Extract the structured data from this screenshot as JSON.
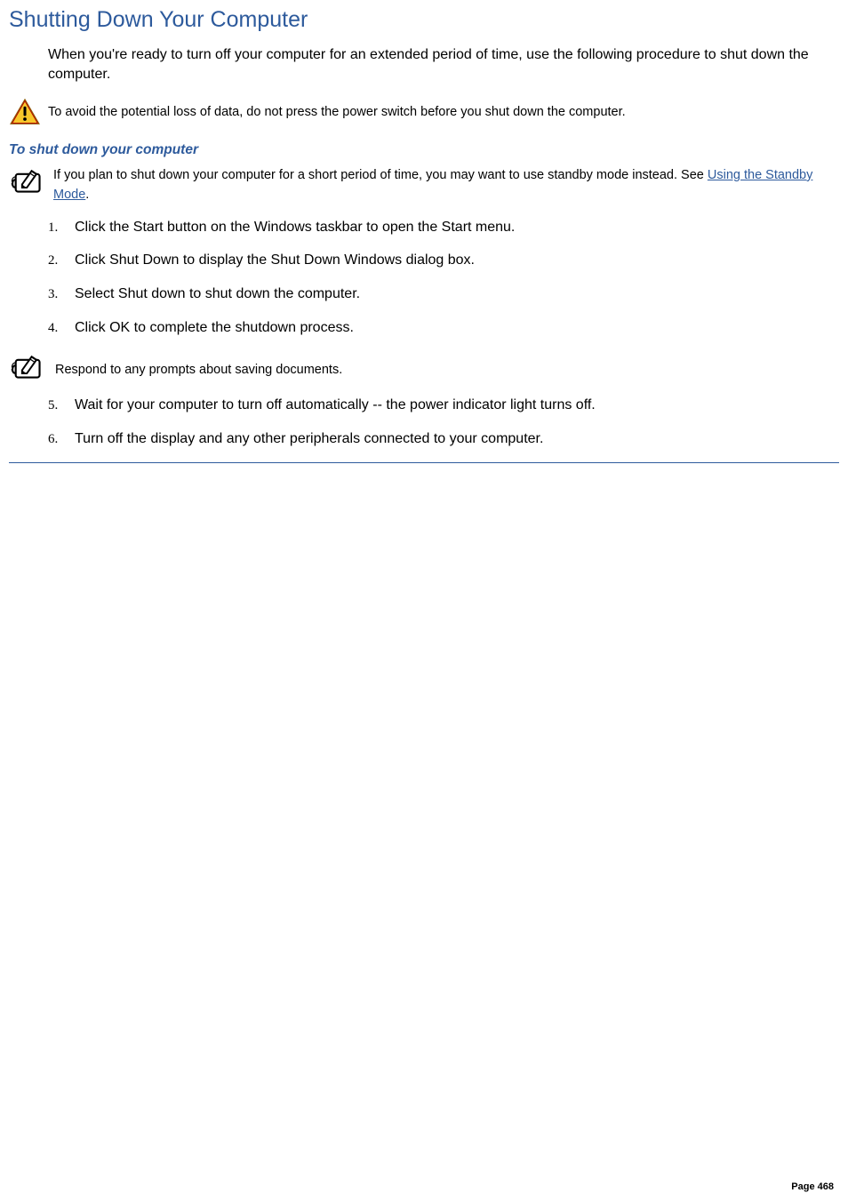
{
  "title": "Shutting Down Your Computer",
  "intro": "When you're ready to turn off your computer for an extended period of time, use the following procedure to shut down the computer.",
  "warning_text": "To avoid the potential loss of data, do not press the power switch before you shut down the computer.",
  "subheading": "To shut down your computer",
  "note1_text_before_link": "If you plan to shut down your computer for a short period of time, you may want to use standby mode instead. See ",
  "note1_link": "Using the Standby Mode",
  "note1_text_after_link": ".",
  "steps_a": [
    "Click the Start button on the Windows taskbar to open the Start menu.",
    "Click Shut Down to display the Shut Down Windows dialog box.",
    "Select Shut down to shut down the computer.",
    "Click OK to complete the shutdown process."
  ],
  "step_nums_a": [
    "1.",
    "2.",
    "3.",
    "4."
  ],
  "mid_note_text": "Respond to any prompts about saving documents.",
  "steps_b": [
    "Wait for your computer to turn off automatically -- the power indicator light turns off.",
    "Turn off the display and any other peripherals connected to your computer."
  ],
  "step_nums_b": [
    "5.",
    "6."
  ],
  "page_number": "Page 468"
}
